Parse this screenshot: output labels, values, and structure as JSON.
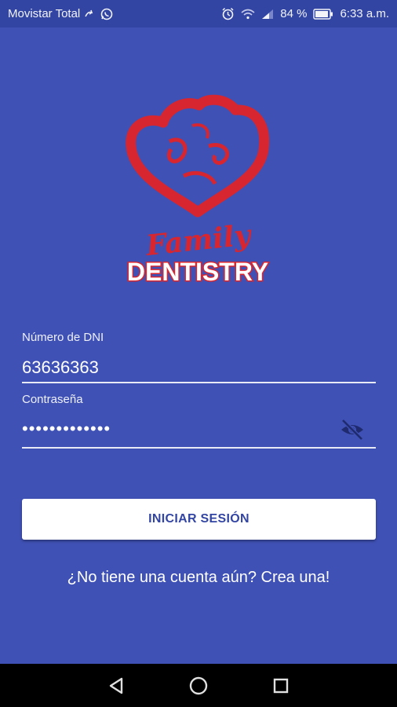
{
  "status_bar": {
    "carrier": "Movistar Total",
    "battery": "84 %",
    "time": "6:33 a.m.",
    "icons": [
      "call-forward-icon",
      "whatsapp-icon",
      "alarm-icon",
      "wifi-icon",
      "signal-icon",
      "battery-icon"
    ]
  },
  "logo": {
    "brand_script": "Family",
    "brand_name": "DENTISTRY",
    "colors": {
      "heart": "#d7262f",
      "wordmark": "#ffffff"
    }
  },
  "form": {
    "dni_label": "Número de DNI",
    "dni_value": "63636363",
    "password_label": "Contraseña",
    "password_value": "•••••••••••••",
    "visibility_icon": "eye-off-icon"
  },
  "login_button": "INICIAR SESIÓN",
  "signup_link": "¿No tiene una cuenta aún? Crea una!",
  "nav_bar": {
    "buttons": [
      "back-icon",
      "home-icon",
      "recents-icon"
    ]
  },
  "colors": {
    "background": "#3f51b5",
    "status_bar": "#3345a3",
    "button_text": "#3345a3"
  }
}
